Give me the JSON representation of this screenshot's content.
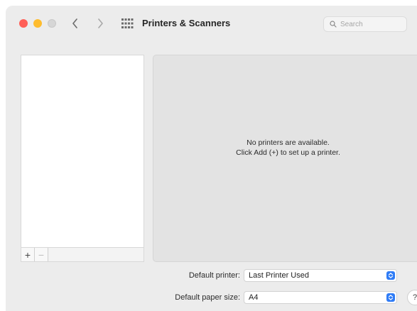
{
  "window": {
    "title": "Printers & Scanners"
  },
  "toolbar": {
    "search_placeholder": "Search",
    "icons": {
      "back": "chevron-left-icon",
      "forward": "chevron-right-icon",
      "show_all": "grid-icon",
      "search": "search-icon"
    }
  },
  "printer_list": {
    "add_label": "+",
    "remove_label": "−"
  },
  "detail": {
    "empty_line1": "No printers are available.",
    "empty_line2": "Click Add (+) to set up a printer."
  },
  "settings": {
    "default_printer_label": "Default printer:",
    "default_printer_value": "Last Printer Used",
    "default_paper_label": "Default paper size:",
    "default_paper_value": "A4"
  },
  "help": {
    "label": "?"
  },
  "colors": {
    "close": "#ff5f57",
    "minimize": "#febc2e",
    "zoom_disabled": "#d6d6d6",
    "accent": "#2f7cf6"
  }
}
